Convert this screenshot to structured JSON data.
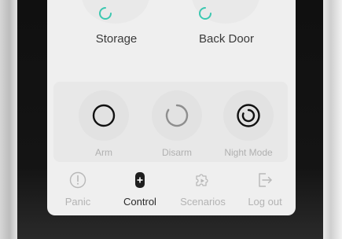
{
  "devices": [
    {
      "label": "Storage",
      "icon": "loading-ring-icon"
    },
    {
      "label": "Back Door",
      "icon": "loading-ring-icon"
    }
  ],
  "modes": [
    {
      "label": "Arm",
      "icon": "arm-ring-icon"
    },
    {
      "label": "Disarm",
      "icon": "disarm-ring-icon"
    },
    {
      "label": "Night Mode",
      "icon": "night-mode-icon"
    }
  ],
  "tabs": [
    {
      "label": "Panic",
      "icon": "exclamation-circle-icon",
      "active": false
    },
    {
      "label": "Control",
      "icon": "remote-control-icon",
      "active": true
    },
    {
      "label": "Scenarios",
      "icon": "puzzle-play-icon",
      "active": false
    },
    {
      "label": "Log out",
      "icon": "logout-icon",
      "active": false
    }
  ],
  "colors": {
    "accent_teal": "#3cc7b0",
    "active_text": "#2a2a2a",
    "inactive_text": "#b3b3b3"
  }
}
